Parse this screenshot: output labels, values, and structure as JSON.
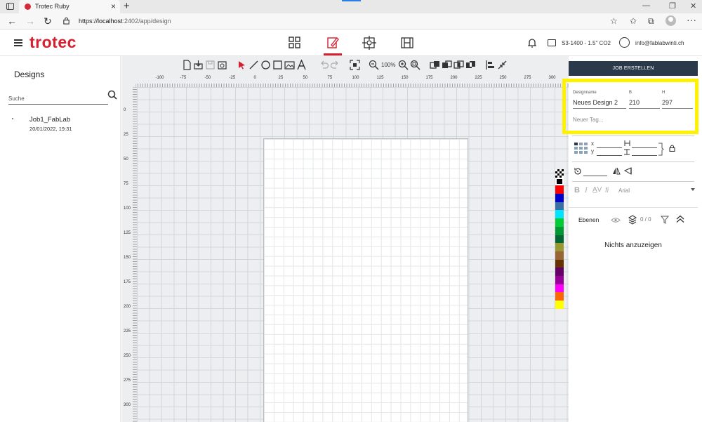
{
  "browser": {
    "tab_title": "Trotec Ruby",
    "tab_close": "×",
    "new_tab": "+",
    "url_scheme": "https://",
    "url_host": "localhost",
    "url_path": ":2402/app/design",
    "minimize": "—",
    "restore": "❐",
    "close": "✕",
    "menu": "···"
  },
  "header": {
    "logo": "trotec",
    "device": "S3-1400 - 1.5\" CO2",
    "user": "info@fablabwinti.ch"
  },
  "left": {
    "heading": "Designs",
    "search_placeholder": "Suche",
    "items": [
      {
        "name": "Job1_FabLab",
        "date": "20/01/2022, 19:31"
      }
    ]
  },
  "toolbar": {
    "zoom": "100%"
  },
  "ruler": {
    "h_labels": [
      "-100",
      "-75",
      "-50",
      "-25",
      "0",
      "25",
      "50",
      "75",
      "100",
      "125",
      "150",
      "175",
      "200",
      "225",
      "250",
      "275",
      "300"
    ],
    "v_labels": [
      "0",
      "25",
      "50",
      "75",
      "100",
      "125",
      "150",
      "175",
      "200",
      "225",
      "250",
      "275",
      "300"
    ]
  },
  "palette": [
    "#ffffff",
    "#000000",
    "#ff0000",
    "#0000cc",
    "#3a6ea5",
    "#00e5ff",
    "#00cc33",
    "#009933",
    "#006633",
    "#999933",
    "#996633",
    "#663300",
    "#660066",
    "#990099",
    "#ff00ff",
    "#ff6600",
    "#ffff00"
  ],
  "right": {
    "job_button": "JOB ERSTELLEN",
    "designname_label": "Designname",
    "designname_value": "Neues Design 2",
    "width_label": "B",
    "width_value": "210",
    "height_label": "H",
    "height_value": "297",
    "tag_placeholder": "Neuer Tag...",
    "x_label": "x",
    "y_label": "y",
    "font_name": "Arial",
    "layers_title": "Ebenen",
    "layers_count": "0 / 0",
    "layers_empty": "Nichts anzuzeigen"
  },
  "colors": {
    "brand": "#d4202f",
    "job_button_bg": "#2a3a4a",
    "highlight": "#fff200"
  }
}
